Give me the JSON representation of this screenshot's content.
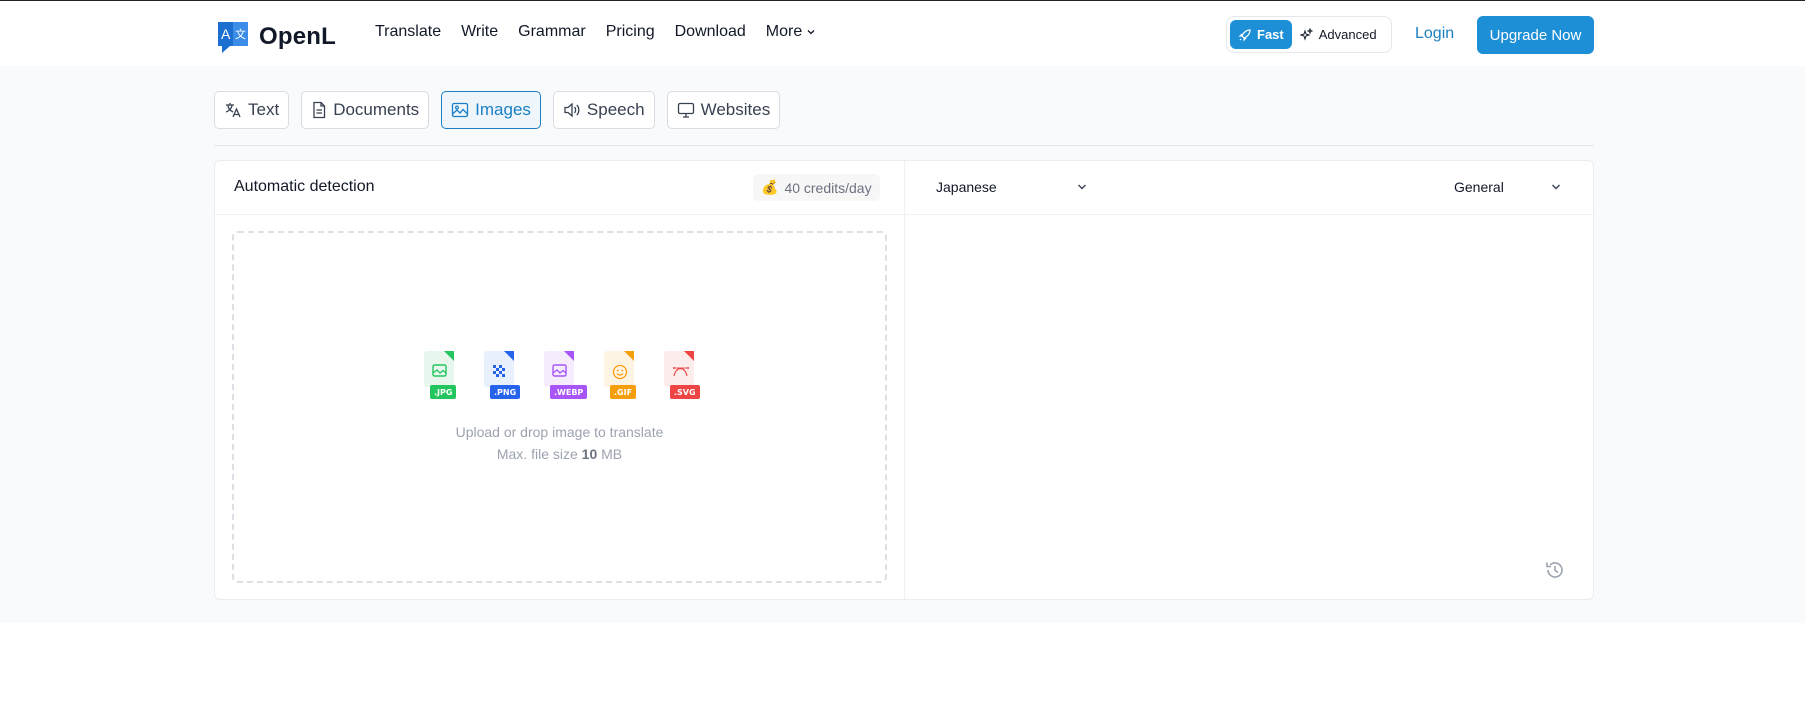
{
  "brand": {
    "name": "OpenL",
    "logo_letter_a": "A",
    "logo_letter_b": "文"
  },
  "nav": [
    {
      "label": "Translate"
    },
    {
      "label": "Write"
    },
    {
      "label": "Grammar"
    },
    {
      "label": "Pricing"
    },
    {
      "label": "Download"
    },
    {
      "label": "More",
      "icon": "chevron-down-icon"
    }
  ],
  "mode": {
    "fast_label": "Fast",
    "fast_icon": "rocket-icon",
    "advanced_label": "Advanced",
    "advanced_icon": "sparkles-icon",
    "active": "Fast"
  },
  "auth": {
    "login_label": "Login",
    "upgrade_label": "Upgrade Now"
  },
  "tabs": [
    {
      "label": "Text",
      "icon": "translate-icon"
    },
    {
      "label": "Documents",
      "icon": "document-icon"
    },
    {
      "label": "Images",
      "icon": "image-icon",
      "active": true
    },
    {
      "label": "Speech",
      "icon": "speaker-icon"
    },
    {
      "label": "Websites",
      "icon": "monitor-icon"
    }
  ],
  "source": {
    "language": "Automatic detection",
    "credits": "40 credits/day",
    "credits_icon": "money-bag-icon"
  },
  "target": {
    "language": "Japanese",
    "domain": "General"
  },
  "upload": {
    "formats": [
      {
        "label": ".JPG",
        "color": "#22c55e"
      },
      {
        "label": ".PNG",
        "color": "#2563eb"
      },
      {
        "label": ".WEBP",
        "color": "#a855f7"
      },
      {
        "label": ".GIF",
        "color": "#f59e0b"
      },
      {
        "label": ".SVG",
        "color": "#ef4444"
      }
    ],
    "instruction": "Upload or drop image to translate",
    "max_prefix": "Max. file size",
    "max_value": "10",
    "max_unit": "MB"
  },
  "colors": {
    "accent": "#1d8fd6",
    "link": "#1a7fc3",
    "band": "#f8fafc"
  }
}
